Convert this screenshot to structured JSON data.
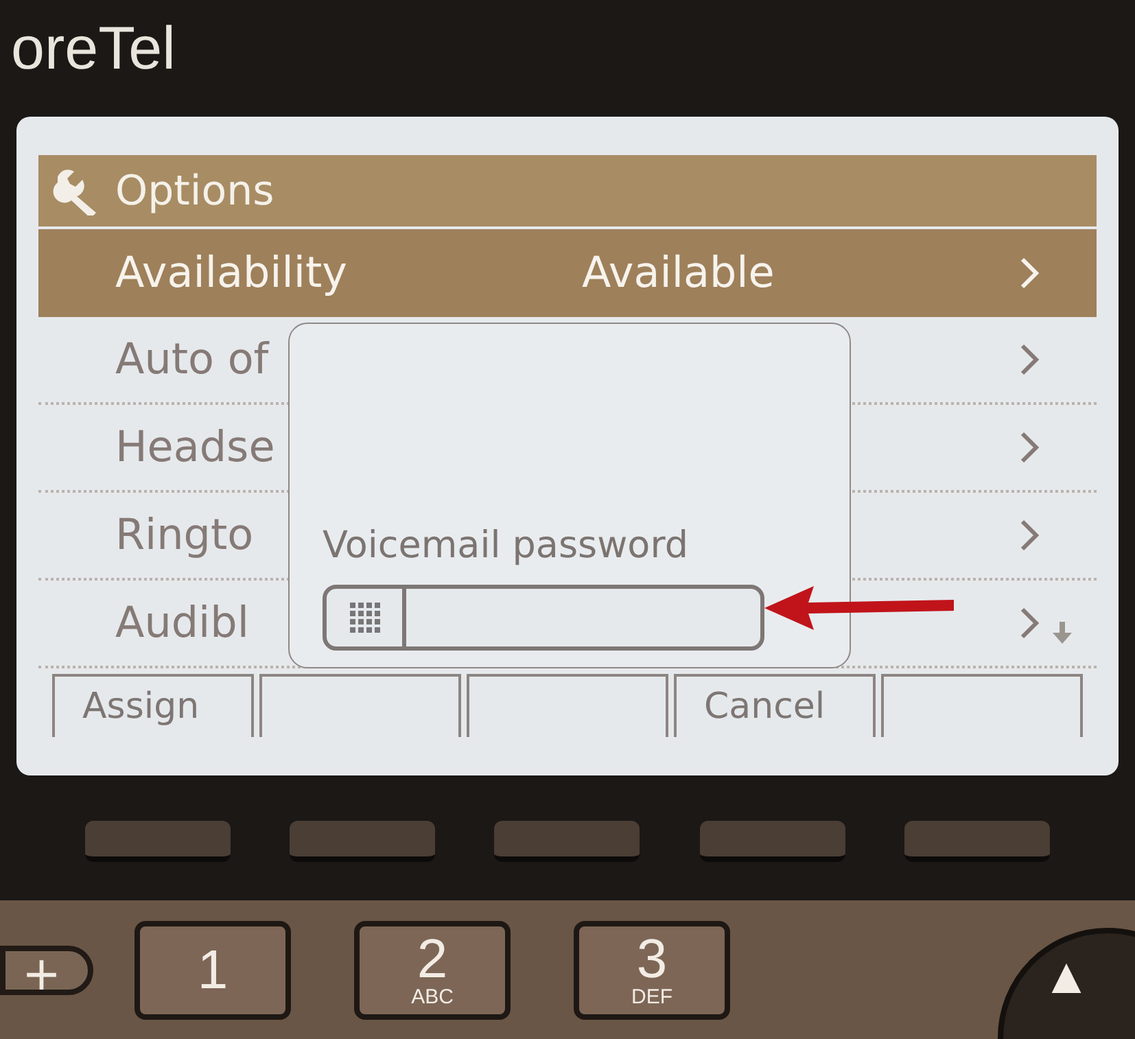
{
  "brand": "oreTel",
  "screen": {
    "title": "Options",
    "menu": [
      {
        "label": "Availability",
        "value": "Available",
        "selected": true
      },
      {
        "label": "Auto of",
        "selected": false
      },
      {
        "label": "Headse",
        "selected": false
      },
      {
        "label": "Ringto",
        "selected": false
      },
      {
        "label": "Audibl",
        "selected": false
      }
    ],
    "dialog": {
      "label": "Voicemail password"
    },
    "softkeys": [
      {
        "kind": "labeled",
        "label": "Assign"
      },
      {
        "kind": "blank"
      },
      {
        "kind": "blank"
      },
      {
        "kind": "labeled",
        "label": "Cancel"
      },
      {
        "kind": "blank"
      }
    ]
  },
  "keypad": {
    "side_key": "+",
    "keys": [
      {
        "digit": "1"
      },
      {
        "digit": "2",
        "letters": "ABC"
      },
      {
        "digit": "3",
        "letters": "DEF"
      }
    ],
    "nav": "▲"
  }
}
